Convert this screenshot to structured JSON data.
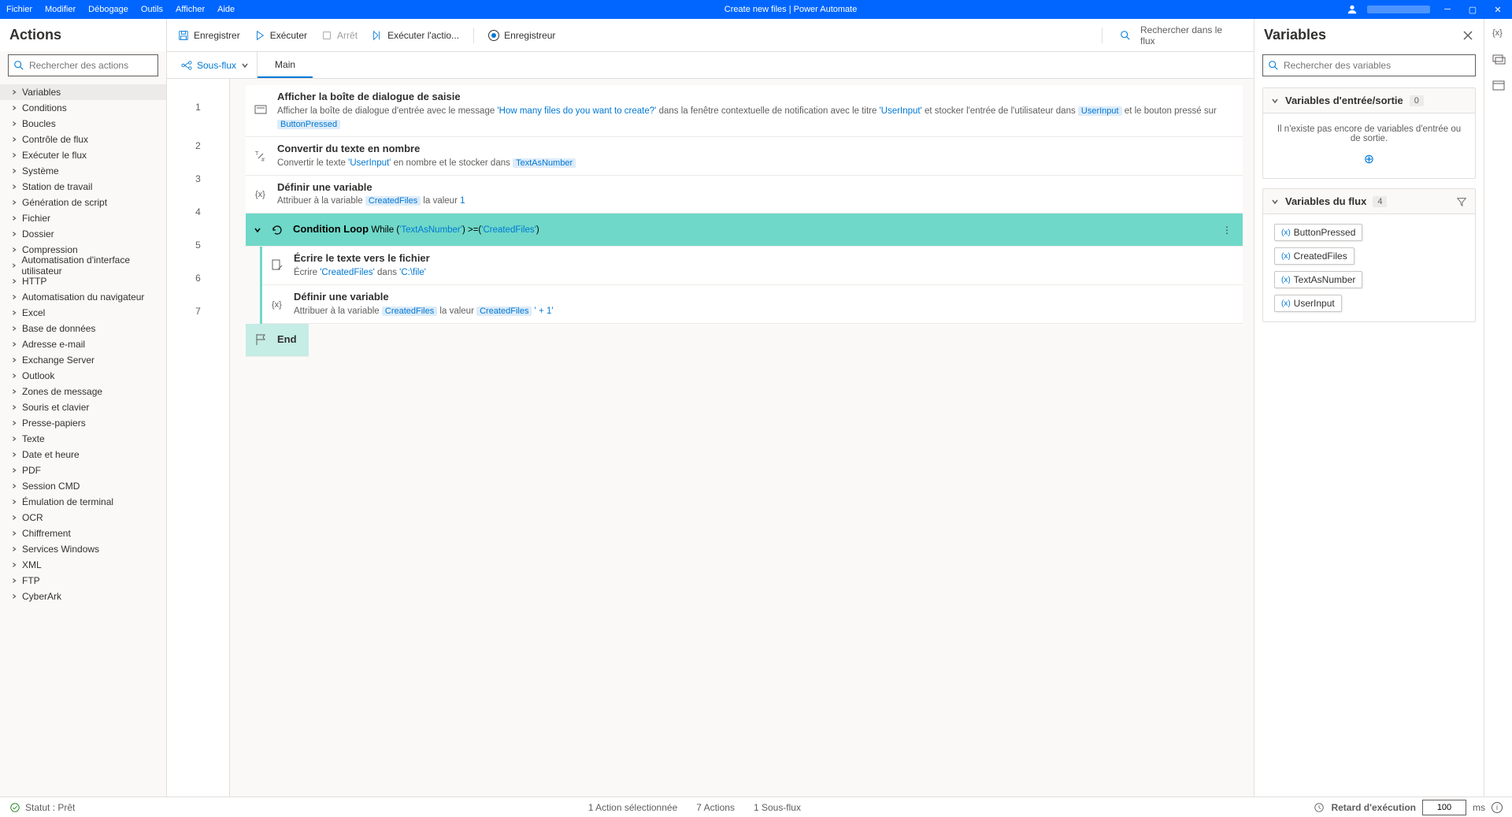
{
  "titlebar": {
    "menus": [
      "Fichier",
      "Modifier",
      "Débogage",
      "Outils",
      "Afficher",
      "Aide"
    ],
    "title": "Create new files | Power Automate"
  },
  "actions_panel": {
    "header": "Actions",
    "search_placeholder": "Rechercher des actions",
    "items": [
      "Variables",
      "Conditions",
      "Boucles",
      "Contrôle de flux",
      "Exécuter le flux",
      "Système",
      "Station de travail",
      "Génération de script",
      "Fichier",
      "Dossier",
      "Compression",
      "Automatisation d'interface utilisateur",
      "HTTP",
      "Automatisation du navigateur",
      "Excel",
      "Base de données",
      "Adresse e-mail",
      "Exchange Server",
      "Outlook",
      "Zones de message",
      "Souris et clavier",
      "Presse-papiers",
      "Texte",
      "Date et heure",
      "PDF",
      "Session CMD",
      "Émulation de terminal",
      "OCR",
      "Chiffrement",
      "Services Windows",
      "XML",
      "FTP",
      "CyberArk"
    ]
  },
  "toolbar": {
    "save": "Enregistrer",
    "run": "Exécuter",
    "stop": "Arrêt",
    "run_action": "Exécuter l'actio...",
    "recorder": "Enregistreur",
    "search_placeholder": "Rechercher dans le flux"
  },
  "tabs": {
    "subflows": "Sous-flux",
    "main": "Main"
  },
  "steps": {
    "s1": {
      "title": "Afficher la boîte de dialogue de saisie",
      "d1": "Afficher la boîte de dialogue d'entrée avec le message ",
      "q1": "'How many files do you want to create?'",
      "d2": " dans la fenêtre contextuelle de notification avec le titre ",
      "q2": "'UserInput'",
      "d3": " et stocker l'entrée de l'utilisateur dans ",
      "t1": "UserInput",
      "d4": " et le bouton pressé sur ",
      "t2": "ButtonPressed"
    },
    "s2": {
      "title": "Convertir du texte en nombre",
      "d1": "Convertir le texte ",
      "q1": "'UserInput'",
      "d2": " en nombre et le stocker dans ",
      "t1": "TextAsNumber"
    },
    "s3": {
      "title": "Définir une variable",
      "d1": "Attribuer à la variable ",
      "t1": "CreatedFiles",
      "d2": " la valeur ",
      "v1": "1"
    },
    "s4": {
      "title": "Condition Loop",
      "d1": "While (",
      "q1": "'TextAsNumber'",
      "d2": ") >=(",
      "q2": "'CreatedFiles'",
      "d3": ")"
    },
    "s5": {
      "title": "Écrire le texte vers le fichier",
      "d1": "Écrire ",
      "q1": "'CreatedFiles'",
      "d2": " dans ",
      "q2": "'C:\\file'"
    },
    "s6": {
      "title": "Définir une variable",
      "d1": "Attribuer à la variable ",
      "t1": "CreatedFiles",
      "d2": " la valeur ",
      "t2": "CreatedFiles",
      "v1": "' + 1'"
    },
    "s7": {
      "title": "End"
    }
  },
  "variables_panel": {
    "header": "Variables",
    "search_placeholder": "Rechercher des variables",
    "io_header": "Variables d'entrée/sortie",
    "io_count": "0",
    "io_empty": "Il n'existe pas encore de variables d'entrée ou de sortie.",
    "flow_header": "Variables du flux",
    "flow_count": "4",
    "chips": [
      "ButtonPressed",
      "CreatedFiles",
      "TextAsNumber",
      "UserInput"
    ]
  },
  "statusbar": {
    "status": "Statut : Prêt",
    "selected": "1 Action sélectionnée",
    "actions": "7 Actions",
    "subflows": "1 Sous-flux",
    "delay_label": "Retard d'exécution",
    "delay_value": "100",
    "delay_unit": "ms"
  }
}
